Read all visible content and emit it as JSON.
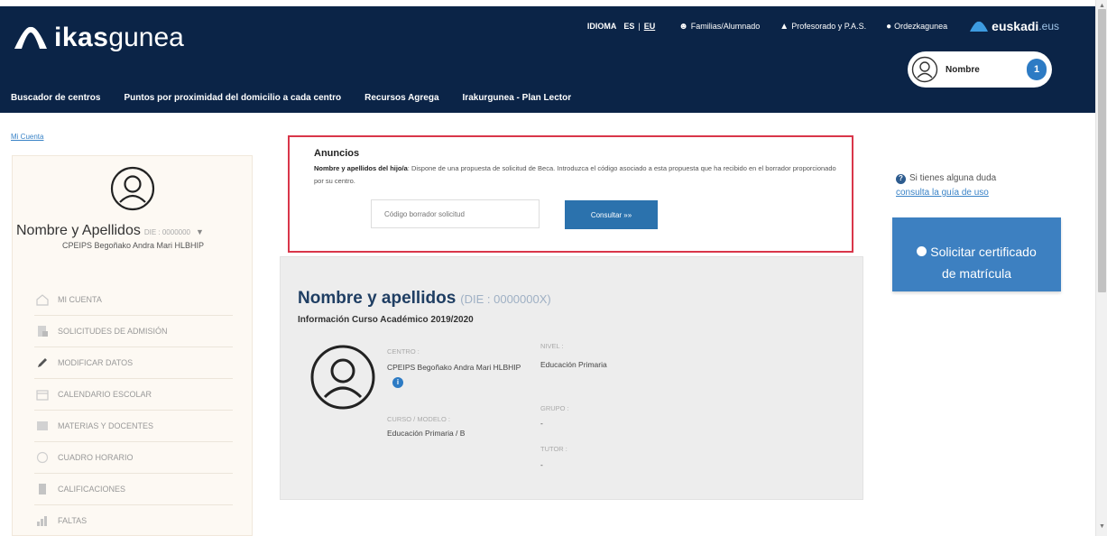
{
  "header": {
    "logo_bold": "ikas",
    "logo_light": "gunea",
    "language_label": "IDIOMA",
    "languages": [
      "ES",
      "EU"
    ],
    "top_links": [
      "Familias/Alumnado",
      "Profesorado y P.A.S.",
      "Ordezkaguneа"
    ],
    "euskadi_bold": "euskadi",
    "euskadi_light": ".eus",
    "user_name": "Nombre",
    "notification_count": "1",
    "nav": [
      "Buscador de centros",
      "Puntos por proximidad del domicilio a cada centro",
      "Recursos Agrega",
      "Irakurgunea - Plan Lector"
    ]
  },
  "breadcrumb": "Mi Cuenta",
  "sidebar": {
    "user_name": "Nombre y Apellidos",
    "user_die": "DIE : 0000000",
    "school": "CPEIPS Begoñako Andra Mari HLBHIP",
    "menu": [
      {
        "label": "MI CUENTA",
        "icon": "home-icon"
      },
      {
        "label": "SOLICITUDES DE ADMISIÓN",
        "icon": "document-icon"
      },
      {
        "label": "MODIFICAR DATOS",
        "icon": "pencil-icon"
      },
      {
        "label": "CALENDARIO ESCOLAR",
        "icon": "calendar-icon"
      },
      {
        "label": "MATERIAS Y DOCENTES",
        "icon": "book-icon"
      },
      {
        "label": "CUADRO HORARIO",
        "icon": "clock-icon"
      },
      {
        "label": "CALIFICACIONES",
        "icon": "grades-icon"
      },
      {
        "label": "FALTAS",
        "icon": "chart-icon"
      }
    ]
  },
  "announcement": {
    "title": "Anuncios",
    "text_bold": "Nombre y apellidos del hijo/a",
    "text": ": Dispone de una propuesta de solicitud de Beca. Introduzca el código asociado a esta propuesta que ha recibido en el borrador proporcionado por su centro.",
    "input_placeholder": "Código borrador solicitud",
    "button_label": "Consultar »»"
  },
  "student": {
    "name": "Nombre y apellidos",
    "die": "(DIE : 0000000X)",
    "course": "Información Curso Académico 2019/2020",
    "centro_label": "CENTRO :",
    "centro_value": "CPEIPS Begoñako Andra Mari HLBHIP",
    "nivel_label": "NIVEL :",
    "nivel_value": "Educación Primaria",
    "grupo_label": "GRUPO :",
    "grupo_value": "-",
    "curso_label": "CURSO / MODELO :",
    "curso_value": "Educación Primaria  /  B",
    "tutor_label": "TUTOR :",
    "tutor_value": "-"
  },
  "help": {
    "text": "Si tienes alguna duda",
    "link": "consulta la guía de uso"
  },
  "certificate_button": {
    "line1": "Solicitar certificado",
    "line2": "de matrícula"
  },
  "colors": {
    "header_bg": "#0b2447",
    "accent_blue": "#2b72ad",
    "announce_border": "#d9364a",
    "student_card_bg": "#ededed"
  }
}
